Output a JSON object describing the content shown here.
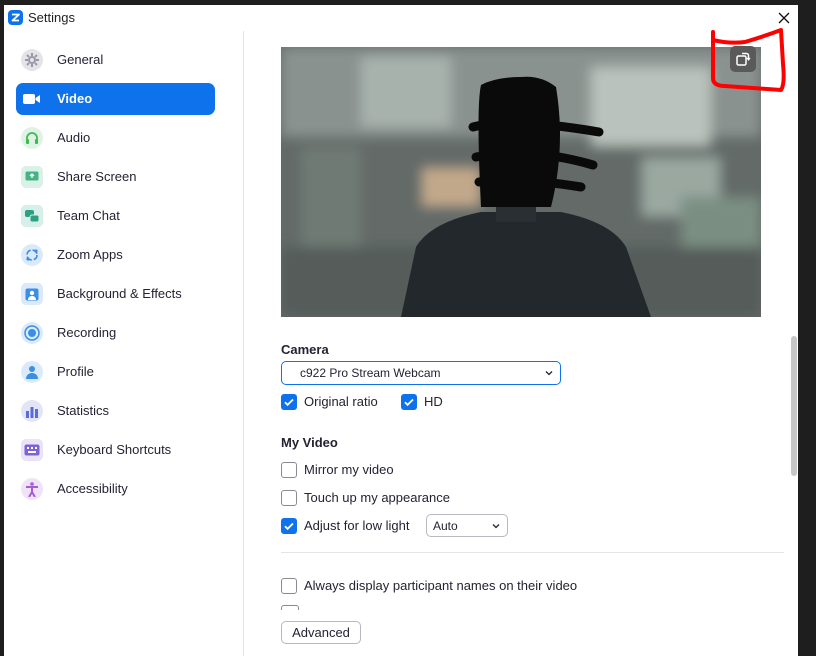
{
  "window": {
    "title": "Settings"
  },
  "sidebar": {
    "items": [
      {
        "label": "General",
        "icon": "gear-icon",
        "color": "#9a9aa6",
        "active": false
      },
      {
        "label": "Video",
        "icon": "video-camera-icon",
        "color": "#0e72ed",
        "active": true
      },
      {
        "label": "Audio",
        "icon": "headphones-icon",
        "color": "#3fb950",
        "active": false
      },
      {
        "label": "Share Screen",
        "icon": "share-screen-icon",
        "color": "#46b387",
        "active": false
      },
      {
        "label": "Team Chat",
        "icon": "chat-bubbles-icon",
        "color": "#2d9f82",
        "active": false
      },
      {
        "label": "Zoom Apps",
        "icon": "apps-icon",
        "color": "#3a8ee6",
        "active": false
      },
      {
        "label": "Background & Effects",
        "icon": "background-portrait-icon",
        "color": "#3a8ee6",
        "active": false
      },
      {
        "label": "Recording",
        "icon": "record-icon",
        "color": "#3a8ee6",
        "active": false
      },
      {
        "label": "Profile",
        "icon": "profile-person-icon",
        "color": "#3a8ee6",
        "active": false
      },
      {
        "label": "Statistics",
        "icon": "bar-chart-icon",
        "color": "#5b6bd8",
        "active": false
      },
      {
        "label": "Keyboard Shortcuts",
        "icon": "keyboard-icon",
        "color": "#7e63d3",
        "active": false
      },
      {
        "label": "Accessibility",
        "icon": "accessibility-icon",
        "color": "#a65cd6",
        "active": false
      }
    ]
  },
  "camera": {
    "section_title": "Camera",
    "selected": "c922 Pro Stream Webcam",
    "original_ratio_label": "Original ratio",
    "original_ratio_checked": true,
    "hd_label": "HD",
    "hd_checked": true
  },
  "my_video": {
    "section_title": "My Video",
    "mirror_label": "Mirror my video",
    "mirror_checked": false,
    "touchup_label": "Touch up my appearance",
    "touchup_checked": false,
    "low_light_label": "Adjust for low light",
    "low_light_checked": true,
    "low_light_mode": "Auto"
  },
  "participant_names_label": "Always display participant names on their video",
  "advanced_label": "Advanced",
  "colors": {
    "accent": "#0e72ed",
    "annotation": "#ff0000"
  }
}
